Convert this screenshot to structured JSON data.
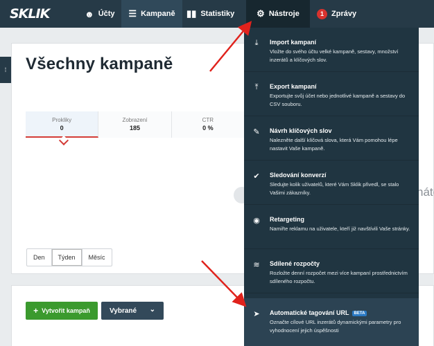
{
  "nav": {
    "logo": "SKLIK",
    "ucty": "Účty",
    "kampane": "Kampaně",
    "statistiky": "Statistiky",
    "nastroje": "Nástroje",
    "zpravy": "Zprávy",
    "zpravy_badge": "1"
  },
  "page": {
    "title": "Všechny kampaně",
    "stats": [
      {
        "label": "Prokliky",
        "value": "0"
      },
      {
        "label": "Zobrazení",
        "value": "185"
      },
      {
        "label": "CTR",
        "value": "0 %"
      }
    ],
    "periods": [
      "Den",
      "Týden",
      "Měsíc"
    ],
    "active_period": "Týden",
    "create_button": "Vytvořit kampaň",
    "select_button": "Vybrané",
    "chart_text_fragment": "náte"
  },
  "tools_menu": [
    {
      "icon": "download-icon",
      "title": "Import kampaní",
      "desc": "Vložte do svého účtu velké kampaně, sestavy, množství inzerátů a klíčových slov."
    },
    {
      "icon": "upload-icon",
      "title": "Export kampaní",
      "desc": "Exportujte svůj účet nebo jednotlivé kampaně a sestavy do CSV souboru."
    },
    {
      "icon": "pencil-icon",
      "title": "Návrh klíčových slov",
      "desc": "Nalezněte další klíčová slova, která Vám pomohou lépe nastavit Vaše kampaně."
    },
    {
      "icon": "check-icon",
      "title": "Sledování konverzí",
      "desc": "Sledujte kolik uživatelů, které Vám Sklik přivedl, se stalo Vašimi zákazníky."
    },
    {
      "icon": "target-icon",
      "title": "Retargeting",
      "desc": "Namiřte reklamu na uživatele, kteří již navštívili Vaše stránky."
    },
    {
      "icon": "coins-icon",
      "title": "Sdílené rozpočty",
      "desc": "Rozložte denní rozpočet mezi více kampaní prostřednictvím sdíleného rozpočtu."
    },
    {
      "icon": "tag-icon",
      "title": "Automatické tagování URL",
      "badge": "BETA",
      "desc": "Označte cílové URL inzerátů dynamickými parametry pro vyhodnocení jejich úspěšnosti"
    }
  ],
  "colors": {
    "topbar": "#263a47",
    "menu_bg": "#203541",
    "accent_red": "#d33b36",
    "create_green": "#3b9a2e"
  }
}
